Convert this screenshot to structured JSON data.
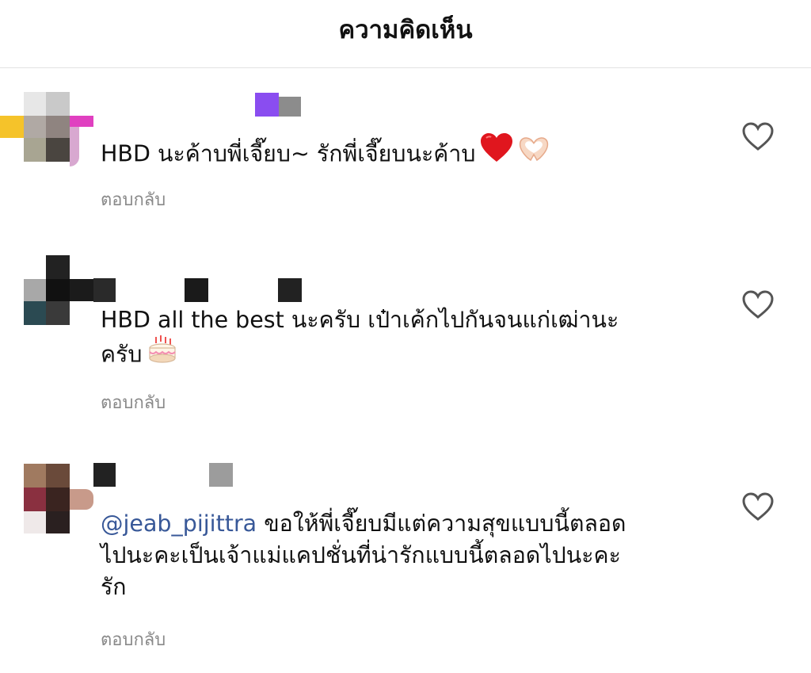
{
  "header": {
    "title": "ความคิดเห็น"
  },
  "comments": [
    {
      "text": "HBD นะค้าบพี่เจี๊ยบ~ รักพี่เจี๊ยบนะค้าบ",
      "emojis": [
        "red-heart-icon",
        "heart-hands-icon"
      ],
      "reply_label": "ตอบกลับ",
      "like_icon": "heart-outline-icon"
    },
    {
      "text_line1": "HBD all the best นะครับ  เป๋าเค้กไปกันจนแก่เฒ่านะ",
      "text_line2": "ครับ",
      "emojis": [
        "birthday-cake-icon"
      ],
      "reply_label": "ตอบกลับ",
      "like_icon": "heart-outline-icon"
    },
    {
      "mention": "@jeab_pijittra",
      "text_line1": " ขอให้พี่เจี๊ยบมีแต่ความสุขแบบนี้ตลอด",
      "text_line2": "ไปนะคะเป็นเจ้าแม่แคปชั่นที่น่ารักแบบนี้ตลอดไปนะคะ",
      "text_line3": "รัก",
      "reply_label": "ตอบกลับ",
      "like_icon": "heart-outline-icon"
    }
  ],
  "colors": {
    "text": "#111111",
    "mention": "#385898",
    "secondary": "#8a8a8a",
    "divider": "#e3e3e3"
  }
}
